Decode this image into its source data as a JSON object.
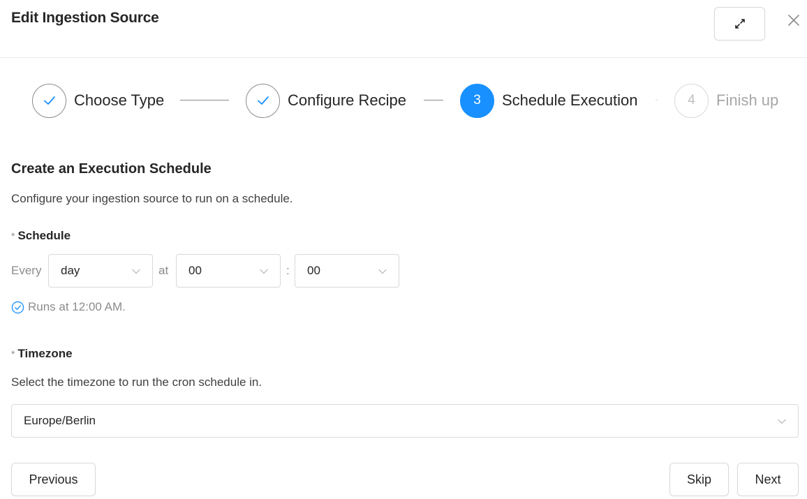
{
  "modal": {
    "title": "Edit Ingestion Source"
  },
  "steps": [
    {
      "label": "Choose Type",
      "status": "done",
      "icon": "check-icon"
    },
    {
      "label": "Configure Recipe",
      "status": "done",
      "icon": "check-icon"
    },
    {
      "label": "Schedule Execution",
      "status": "active",
      "number": "3"
    },
    {
      "label": "Finish up",
      "status": "pending",
      "number": "4"
    }
  ],
  "section": {
    "title": "Create an Execution Schedule",
    "description": "Configure your ingestion source to run on a schedule."
  },
  "schedule": {
    "required_mark": "*",
    "label": "Schedule",
    "every_text": "Every",
    "interval_value": "day",
    "at_text": "at",
    "hour_value": "00",
    "colon": ":",
    "minute_value": "00",
    "runs_text": "Runs at 12:00 AM."
  },
  "timezone": {
    "required_mark": "*",
    "label": "Timezone",
    "description": "Select the timezone to run the cron schedule in.",
    "value": "Europe/Berlin"
  },
  "footer": {
    "previous_label": "Previous",
    "skip_label": "Skip",
    "next_label": "Next"
  },
  "colors": {
    "accent": "#1890ff",
    "border": "#d9d9d9",
    "muted_text": "#8c8c8c"
  }
}
